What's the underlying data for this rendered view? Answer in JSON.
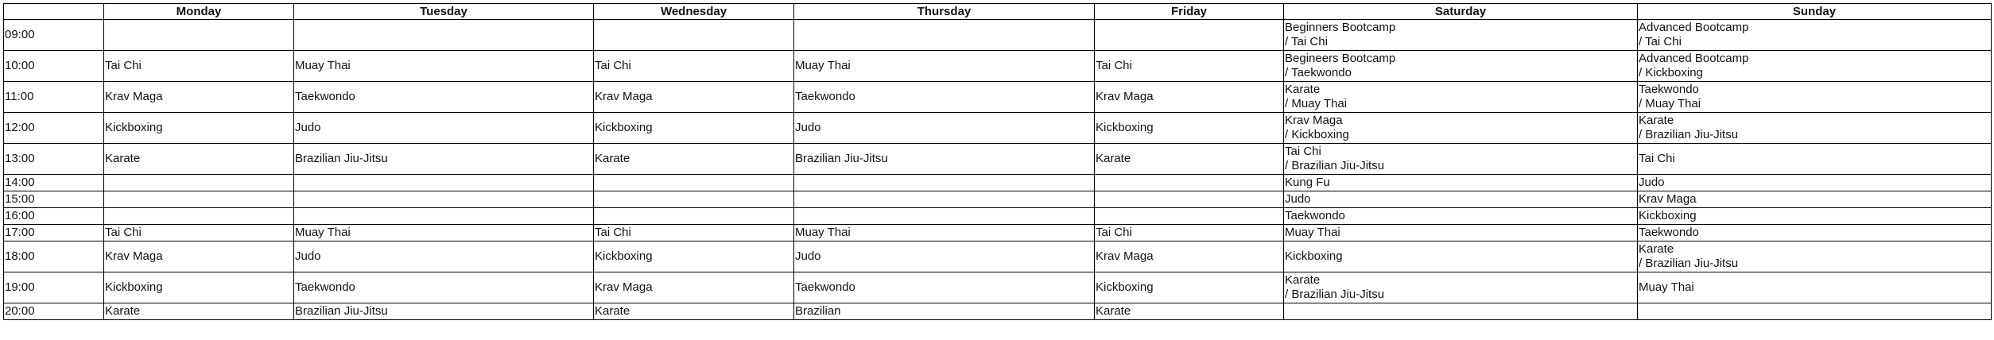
{
  "header": {
    "time": "",
    "days": [
      "Monday",
      "Tuesday",
      "Wednesday",
      "Thursday",
      "Friday",
      "Saturday",
      "Sunday"
    ]
  },
  "rows": [
    {
      "time": "09:00",
      "cells": [
        [
          ""
        ],
        [
          ""
        ],
        [
          ""
        ],
        [
          ""
        ],
        [
          ""
        ],
        [
          "Beginners Bootcamp",
          "/ Tai Chi"
        ],
        [
          "Advanced Bootcamp",
          "/ Tai Chi"
        ]
      ]
    },
    {
      "time": "10:00",
      "cells": [
        [
          "Tai Chi"
        ],
        [
          "Muay Thai"
        ],
        [
          "Tai Chi"
        ],
        [
          "Muay Thai"
        ],
        [
          "Tai Chi"
        ],
        [
          "Begineers Bootcamp",
          "/ Taekwondo"
        ],
        [
          "Advanced Bootcamp",
          "/ Kickboxing"
        ]
      ]
    },
    {
      "time": "11:00",
      "cells": [
        [
          "Krav Maga"
        ],
        [
          "Taekwondo"
        ],
        [
          "Krav Maga"
        ],
        [
          "Taekwondo"
        ],
        [
          "Krav Maga"
        ],
        [
          "Karate",
          "/ Muay Thai"
        ],
        [
          "Taekwondo",
          "/ Muay Thai"
        ]
      ]
    },
    {
      "time": "12:00",
      "cells": [
        [
          "Kickboxing"
        ],
        [
          "Judo"
        ],
        [
          "Kickboxing"
        ],
        [
          "Judo"
        ],
        [
          "Kickboxing"
        ],
        [
          "Krav Maga",
          "/ Kickboxing"
        ],
        [
          "Karate",
          "/ Brazilian Jiu-Jitsu"
        ]
      ]
    },
    {
      "time": "13:00",
      "cells": [
        [
          "Karate"
        ],
        [
          "Brazilian Jiu-Jitsu"
        ],
        [
          "Karate"
        ],
        [
          "Brazilian Jiu-Jitsu"
        ],
        [
          "Karate"
        ],
        [
          "Tai Chi",
          "/ Brazilian Jiu-Jitsu"
        ],
        [
          "Tai Chi"
        ]
      ]
    },
    {
      "time": "14:00",
      "cells": [
        [
          ""
        ],
        [
          ""
        ],
        [
          ""
        ],
        [
          ""
        ],
        [
          ""
        ],
        [
          "Kung Fu"
        ],
        [
          "Judo"
        ]
      ]
    },
    {
      "time": "15:00",
      "cells": [
        [
          ""
        ],
        [
          ""
        ],
        [
          ""
        ],
        [
          ""
        ],
        [
          ""
        ],
        [
          "Judo"
        ],
        [
          "Krav Maga"
        ]
      ]
    },
    {
      "time": "16:00",
      "cells": [
        [
          ""
        ],
        [
          ""
        ],
        [
          ""
        ],
        [
          ""
        ],
        [
          ""
        ],
        [
          "Taekwondo"
        ],
        [
          "Kickboxing"
        ]
      ]
    },
    {
      "time": "17:00",
      "cells": [
        [
          "Tai Chi"
        ],
        [
          "Muay Thai"
        ],
        [
          "Tai Chi"
        ],
        [
          "Muay Thai"
        ],
        [
          "Tai Chi"
        ],
        [
          "Muay Thai"
        ],
        [
          "Taekwondo"
        ]
      ]
    },
    {
      "time": "18:00",
      "cells": [
        [
          "Krav Maga"
        ],
        [
          "Judo"
        ],
        [
          "Kickboxing"
        ],
        [
          "Judo"
        ],
        [
          "Krav Maga"
        ],
        [
          "Kickboxing"
        ],
        [
          "Karate",
          "/ Brazilian Jiu-Jitsu"
        ]
      ]
    },
    {
      "time": "19:00",
      "cells": [
        [
          "Kickboxing"
        ],
        [
          "Taekwondo"
        ],
        [
          "Krav Maga"
        ],
        [
          "Taekwondo"
        ],
        [
          "Kickboxing"
        ],
        [
          "Karate",
          "/ Brazilian Jiu-Jitsu"
        ],
        [
          "Muay Thai"
        ]
      ]
    },
    {
      "time": "20:00",
      "cells": [
        [
          "Karate"
        ],
        [
          "Brazilian Jiu-Jitsu"
        ],
        [
          "Karate"
        ],
        [
          "Brazilian"
        ],
        [
          "Karate"
        ],
        [
          ""
        ],
        [
          ""
        ]
      ]
    }
  ]
}
